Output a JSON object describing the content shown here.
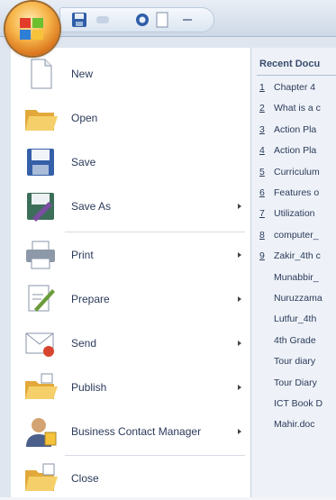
{
  "menu": {
    "items": [
      {
        "label": "New",
        "icon": "new-document-icon",
        "has_submenu": false
      },
      {
        "label": "Open",
        "icon": "open-folder-icon",
        "has_submenu": false
      },
      {
        "label": "Save",
        "icon": "save-disk-icon",
        "has_submenu": false
      },
      {
        "label": "Save As",
        "icon": "save-as-icon",
        "has_submenu": true
      },
      {
        "label": "Print",
        "icon": "printer-icon",
        "has_submenu": true
      },
      {
        "label": "Prepare",
        "icon": "prepare-icon",
        "has_submenu": true
      },
      {
        "label": "Send",
        "icon": "send-icon",
        "has_submenu": true
      },
      {
        "label": "Publish",
        "icon": "publish-icon",
        "has_submenu": true
      },
      {
        "label": "Business Contact Manager",
        "icon": "contact-manager-icon",
        "has_submenu": true
      },
      {
        "label": "Close",
        "icon": "close-folder-icon",
        "has_submenu": false
      }
    ]
  },
  "recent": {
    "title": "Recent Docu",
    "items": [
      {
        "num": "1",
        "name": "Chapter 4"
      },
      {
        "num": "2",
        "name": "What is a c"
      },
      {
        "num": "3",
        "name": "Action Pla"
      },
      {
        "num": "4",
        "name": "Action Pla"
      },
      {
        "num": "5",
        "name": "Curriculum"
      },
      {
        "num": "6",
        "name": "Features o"
      },
      {
        "num": "7",
        "name": "Utilization"
      },
      {
        "num": "8",
        "name": "computer_"
      },
      {
        "num": "9",
        "name": "Zakir_4th c"
      },
      {
        "num": "",
        "name": "Munabbir_"
      },
      {
        "num": "",
        "name": "Nuruzzama"
      },
      {
        "num": "",
        "name": "Lutfur_4th"
      },
      {
        "num": "",
        "name": "4th Grade"
      },
      {
        "num": "",
        "name": "Tour diary"
      },
      {
        "num": "",
        "name": "Tour Diary"
      },
      {
        "num": "",
        "name": "ICT Book D"
      },
      {
        "num": "",
        "name": "Mahir.doc"
      }
    ]
  },
  "colors": {
    "orb": "#e08a2a",
    "menu_bg": "#dfe6ef",
    "text": "#2b3a5a"
  }
}
